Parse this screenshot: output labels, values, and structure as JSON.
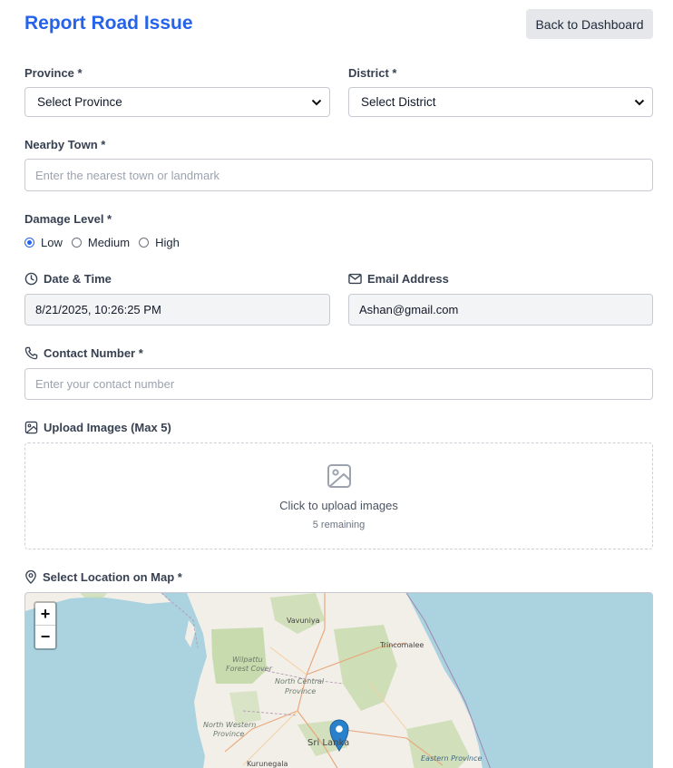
{
  "header": {
    "title": "Report Road Issue",
    "back_label": "Back to Dashboard"
  },
  "province": {
    "label": "Province *",
    "value": "Select Province"
  },
  "district": {
    "label": "District *",
    "value": "Select District"
  },
  "town": {
    "label": "Nearby Town *",
    "placeholder": "Enter the nearest town or landmark"
  },
  "damage": {
    "label": "Damage Level *",
    "options": [
      "Low",
      "Medium",
      "High"
    ],
    "selected": "Low"
  },
  "datetime": {
    "label": "Date & Time",
    "value": "8/21/2025, 10:26:25 PM"
  },
  "email": {
    "label": "Email Address",
    "value": "Ashan@gmail.com"
  },
  "contact": {
    "label": "Contact Number *",
    "placeholder": "Enter your contact number"
  },
  "upload": {
    "label": "Upload Images (Max 5)",
    "text": "Click to upload images",
    "remaining": "5 remaining"
  },
  "map": {
    "label": "Select Location on Map *",
    "zoom_in": "+",
    "zoom_out": "−",
    "places": {
      "vavuniya": "Vavuniya",
      "trincomalee": "Trincomalee",
      "wilpattu_1": "Wilpattu",
      "wilpattu_2": "Forest Cover",
      "ncp_1": "North Central",
      "ncp_2": "Province",
      "nwp_1": "North Western",
      "nwp_2": "Province",
      "srilanka": "Sri Lanka",
      "eastern": "Eastern Province",
      "kurunegala": "Kurunegala"
    }
  },
  "colors": {
    "accent": "#2563eb",
    "sea": "#aad3df",
    "land": "#f2efe9",
    "forest": "#c8dbae"
  }
}
